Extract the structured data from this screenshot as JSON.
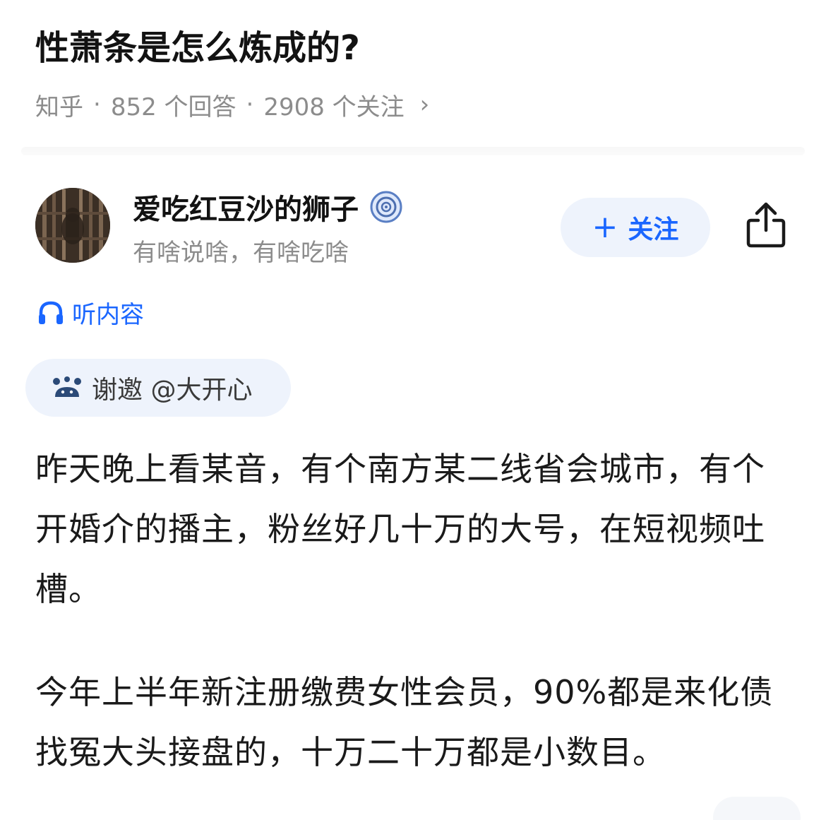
{
  "question": {
    "title": "性萧条是怎么炼成的?",
    "source": "知乎",
    "answers": "852 个回答",
    "followers": "2908 个关注",
    "separator": "·",
    "chevron": "›"
  },
  "author": {
    "name": "爱吃红豆沙的狮子",
    "bio": "有啥说啥，有啥吃啥",
    "badge_icon": "verified-badge-icon",
    "avatar_icon": "avatar-image"
  },
  "actions": {
    "follow_plus": "+",
    "follow_label": "关注",
    "share_icon": "share-icon"
  },
  "listen": {
    "label": "听内容",
    "icon": "headphones-icon"
  },
  "invite": {
    "label": "谢邀 @大开心",
    "icon": "invite-icon"
  },
  "content": {
    "paragraphs": [
      "昨天晚上看某音，有个南方某二线省会城市，有个开婚介的播主，粉丝好几十万的大号，在短视频吐槽。",
      "今年上半年新注册缴费女性会员，90%都是来化债找冤大头接盘的，十万二十万都是小数目。"
    ]
  },
  "colors": {
    "accent": "#1a66ff",
    "pill_bg": "#eef3fc",
    "meta_gray": "#8c8c8c",
    "text": "#1a1a1a"
  }
}
